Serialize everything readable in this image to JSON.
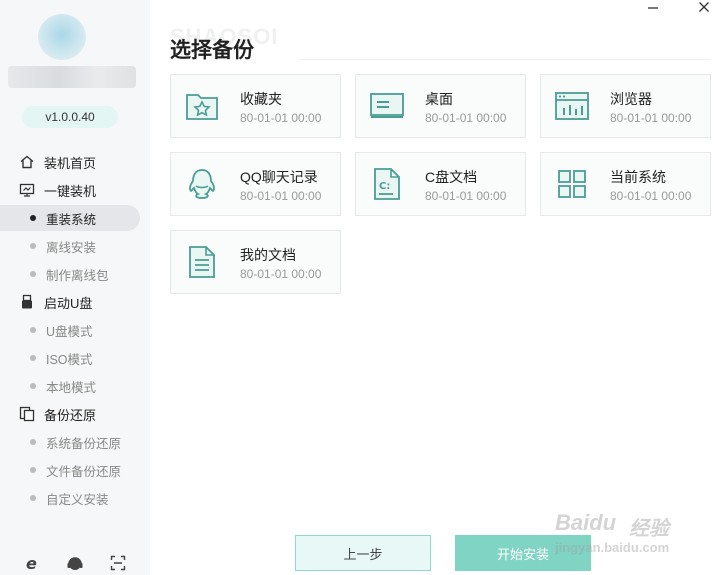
{
  "sidebar": {
    "version": "v1.0.0.40",
    "groups": [
      {
        "label": "装机首页",
        "icon": "home-icon",
        "items": []
      },
      {
        "label": "一键装机",
        "icon": "monitor-icon",
        "items": [
          {
            "label": "重装系统",
            "active": true
          },
          {
            "label": "离线安装"
          },
          {
            "label": "制作离线包"
          }
        ]
      },
      {
        "label": "启动U盘",
        "icon": "usb-icon",
        "items": [
          {
            "label": "U盘模式"
          },
          {
            "label": "ISO模式"
          },
          {
            "label": "本地模式"
          }
        ]
      },
      {
        "label": "备份还原",
        "icon": "backup-icon",
        "items": [
          {
            "label": "系统备份还原"
          },
          {
            "label": "文件备份还原"
          },
          {
            "label": "自定义安装"
          }
        ]
      }
    ],
    "bottom_icons": [
      "ie-icon",
      "support-icon",
      "scan-icon"
    ]
  },
  "window": {
    "minimize_icon": "minimize-icon",
    "close_icon": "close-icon"
  },
  "main": {
    "watermark": "SHAOSOI",
    "title": "选择备份",
    "cards": [
      {
        "name": "收藏夹",
        "time": "80-01-01 00:00",
        "icon": "favorites-folder-icon"
      },
      {
        "name": "桌面",
        "time": "80-01-01 00:00",
        "icon": "desktop-icon"
      },
      {
        "name": "浏览器",
        "time": "80-01-01 00:00",
        "icon": "browser-icon"
      },
      {
        "name": "QQ聊天记录",
        "time": "80-01-01 00:00",
        "icon": "qq-icon"
      },
      {
        "name": "C盘文档",
        "time": "80-01-01 00:00",
        "icon": "c-drive-document-icon"
      },
      {
        "name": "当前系统",
        "time": "80-01-01 00:00",
        "icon": "system-grid-icon"
      },
      {
        "name": "我的文档",
        "time": "80-01-01 00:00",
        "icon": "my-documents-icon"
      }
    ]
  },
  "footer": {
    "prev_label": "上一步",
    "start_label": "开始安装"
  },
  "overlay": {
    "baidu_line1": "Baidu",
    "baidu_line2": "经验",
    "baidu_line3": "jingyan.baidu.com"
  },
  "colors": {
    "accent": "#7fd4c4",
    "accent_light": "#e8f8f6",
    "icon_teal": "#4a9d93",
    "sidebar_bg": "#f6f7f8"
  }
}
